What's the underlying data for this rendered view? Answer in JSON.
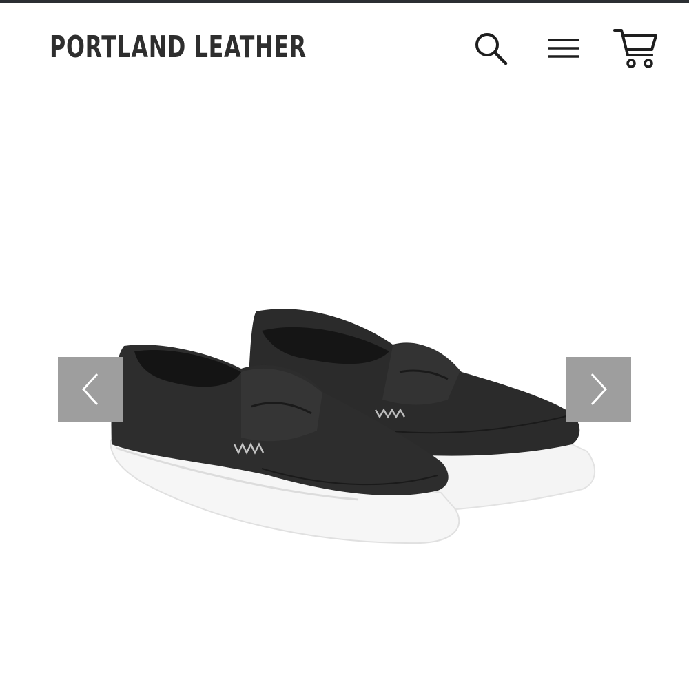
{
  "header": {
    "brand": "PORTLAND LEATHER",
    "icons": {
      "search": "search-icon",
      "menu": "hamburger-menu-icon",
      "cart": "shopping-cart-icon"
    }
  },
  "gallery": {
    "product_image": "black-penny-loafer-sneakers",
    "prev_icon": "chevron-left-icon",
    "next_icon": "chevron-right-icon"
  },
  "colors": {
    "top_rule": "#2b2f33",
    "text": "#2e2e2e",
    "arrow_bg": "#9e9e9e",
    "shoe": "#2a2a2a",
    "sole": "#ffffff"
  }
}
